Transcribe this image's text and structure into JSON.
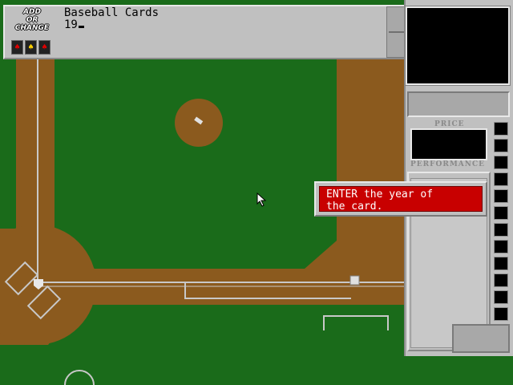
{
  "app": {
    "logo_text_lines": [
      "ADD",
      "OR",
      "CHANGE"
    ],
    "logo_icons": [
      "card-red-icon",
      "card-yellow-icon",
      "card-red-icon"
    ]
  },
  "entry": {
    "title": "Baseball Cards",
    "input_value": "19"
  },
  "panel": {
    "price_label": "PRICE",
    "performance_label": "PERFORMANCE"
  },
  "dialog": {
    "line1": "ENTER the year of",
    "line2": "the card."
  },
  "colors": {
    "field_green": "#1a6b1a",
    "dirt_brown": "#8b5a1e",
    "panel_gray": "#c0c0c0",
    "dialog_red": "#c80000"
  }
}
